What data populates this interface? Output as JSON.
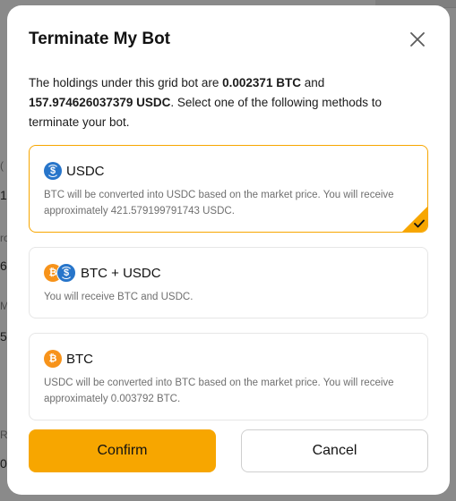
{
  "background": {
    "fragments": [
      "(",
      "1",
      "ro",
      "6",
      "M",
      "5",
      "R",
      "0"
    ]
  },
  "modal": {
    "title": "Terminate My Bot",
    "description": {
      "prefix": "The holdings under this grid bot are ",
      "btc_amount": "0.002371 BTC",
      "middle": " and ",
      "usdc_amount": "157.974626037379 USDC",
      "suffix": ". Select one of the following methods to terminate your bot."
    },
    "options": [
      {
        "title": "USDC",
        "icon": "usdc-icon",
        "description": "BTC will be converted into USDC based on the market price. You will receive approximately 421.579199791743 USDC.",
        "selected": true
      },
      {
        "title": "BTC + USDC",
        "icon": "btc-usdc-icon",
        "description": "You will receive BTC and USDC.",
        "selected": false
      },
      {
        "title": "BTC",
        "icon": "btc-icon",
        "description": "USDC will be converted into BTC based on the market price. You will receive approximately 0.003792 BTC.",
        "selected": false
      }
    ],
    "confirm_label": "Confirm",
    "cancel_label": "Cancel"
  },
  "colors": {
    "accent": "#f7a600",
    "usdc": "#2775ca",
    "btc": "#f7931a"
  }
}
